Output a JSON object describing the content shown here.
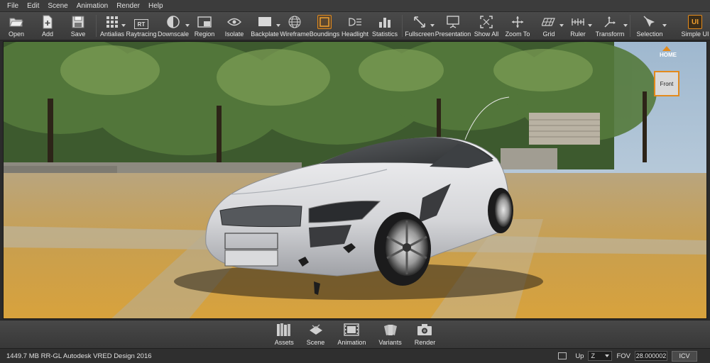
{
  "menu": [
    "File",
    "Edit",
    "Scene",
    "Animation",
    "Render",
    "Help"
  ],
  "toolbar": {
    "open": "Open",
    "add": "Add",
    "save": "Save",
    "antialias": "Antialias",
    "raytracing": "Raytracing",
    "raytracing_icon_text": "RT",
    "downscale": "Downscale",
    "region": "Region",
    "isolate": "Isolate",
    "backplate": "Backplate",
    "wireframe": "Wireframe",
    "boundings": "Boundings",
    "headlight": "Headlight",
    "statistics": "Statistics",
    "fullscreen": "Fullscreen",
    "presentation": "Presentation",
    "show_all": "Show All",
    "zoom_to": "Zoom To",
    "grid": "Grid",
    "ruler": "Ruler",
    "transform": "Transform",
    "selection": "Selection",
    "simple_ui": "Simple UI",
    "simple_ui_icon_text": "UI"
  },
  "viewport": {
    "nav_home": "HOME",
    "nav_front": "Front"
  },
  "modules": {
    "assets": "Assets",
    "scene": "Scene",
    "animation": "Animation",
    "variants": "Variants",
    "render": "Render"
  },
  "status": {
    "info": "1449.7 MB  RR-GL  Autodesk VRED Design 2016",
    "up_label": "Up",
    "up_value": "Z",
    "fov_label": "FOV",
    "fov_value": "28.000002",
    "icv": "ICV"
  },
  "colors": {
    "accent": "#e38a1c",
    "chrome": "#3c3c3c",
    "ground": "#c9a054"
  }
}
